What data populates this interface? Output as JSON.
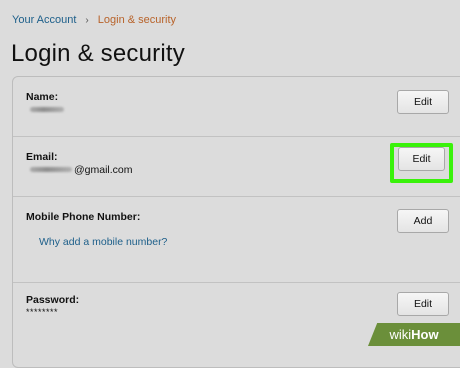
{
  "breadcrumb": {
    "parent": "Your Account",
    "separator": "›",
    "current": "Login & security"
  },
  "page_title": "Login & security",
  "rows": {
    "name": {
      "label": "Name:",
      "button": "Edit"
    },
    "email": {
      "label": "Email:",
      "value_suffix": "@gmail.com",
      "button": "Edit"
    },
    "phone": {
      "label": "Mobile Phone Number:",
      "link": "Why add a mobile number?",
      "button": "Add"
    },
    "password": {
      "label": "Password:",
      "value": "********",
      "button": "Edit"
    }
  },
  "watermark": {
    "part1": "wiki",
    "part2": "How"
  },
  "colors": {
    "highlight": "#39f20a",
    "link": "#1d5f8a",
    "crumb_current": "#b8632a"
  }
}
